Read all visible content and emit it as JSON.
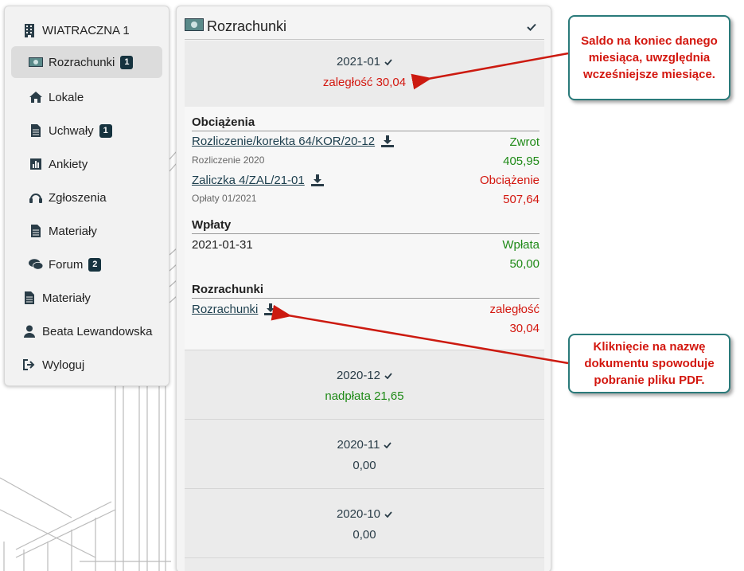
{
  "sidebar": {
    "building": "WIATRACZNA 1",
    "items": [
      {
        "label": "Rozrachunki",
        "badge": "1"
      },
      {
        "label": "Lokale"
      },
      {
        "label": "Uchwały",
        "badge": "1"
      },
      {
        "label": "Ankiety"
      },
      {
        "label": "Zgłoszenia"
      },
      {
        "label": "Materiały"
      },
      {
        "label": "Forum",
        "badge": "2"
      }
    ],
    "bottom": [
      {
        "label": "Materiały"
      },
      {
        "label": "Beata Lewandowska"
      },
      {
        "label": "Wyloguj"
      }
    ]
  },
  "main": {
    "title": "Rozrachunki",
    "months": [
      {
        "label": "2021-01",
        "value": "zaległość 30,04",
        "status": "debt"
      },
      {
        "label": "2020-12",
        "value": "nadpłata 21,65",
        "status": "credit"
      },
      {
        "label": "2020-11",
        "value": "0,00",
        "status": "zero"
      },
      {
        "label": "2020-10",
        "value": "0,00",
        "status": "zero"
      }
    ],
    "detail": {
      "charges_title": "Obciążenia",
      "charges": [
        {
          "doc": "Rozliczenie/korekta 64/KOR/20-12",
          "sub": "Rozliczenie 2020",
          "type": "Zwrot",
          "amount": "405,95"
        },
        {
          "doc": "Zaliczka 4/ZAL/21-01",
          "sub": "Opłaty 01/2021",
          "type": "Obciążenie",
          "amount": "507,64"
        }
      ],
      "payments_title": "Wpłaty",
      "payments": [
        {
          "date": "2021-01-31",
          "type": "Wpłata",
          "amount": "50,00"
        }
      ],
      "settlements_title": "Rozrachunki",
      "settlements": [
        {
          "doc": "Rozrachunki",
          "type": "zaległość",
          "amount": "30,04"
        }
      ]
    }
  },
  "callouts": {
    "balance": "Saldo na koniec danego miesiąca, uwzględnia wcześniejsze miesiące.",
    "download": "Kliknięcie na nazwę dokumentu spowoduje pobranie pliku PDF."
  },
  "colors": {
    "accent": "#16333f",
    "debt": "#d3170f",
    "credit": "#1f8a17",
    "callout_border": "#2a7a7a"
  }
}
